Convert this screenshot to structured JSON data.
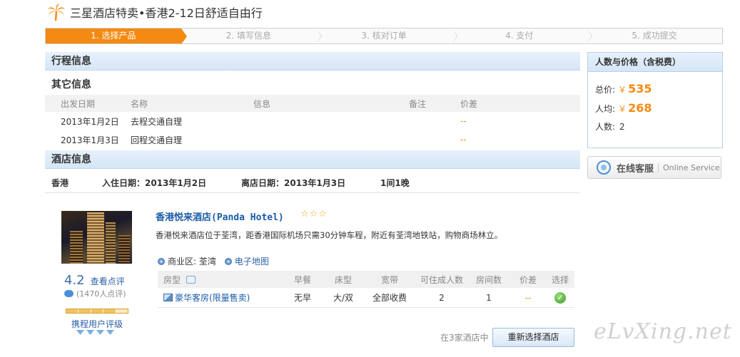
{
  "page": {
    "title": "三星酒店特卖•香港2-12日舒适自由行"
  },
  "steps": [
    {
      "label": "1. 选择产品"
    },
    {
      "label": "2. 填写信息"
    },
    {
      "label": "3. 核对订单"
    },
    {
      "label": "4. 支付"
    },
    {
      "label": "5. 成功提交"
    }
  ],
  "itinerary": {
    "section_title": "行程信息",
    "other_title": "其它信息",
    "headers": {
      "date": "出发日期",
      "name": "名称",
      "info": "信息",
      "note": "备注",
      "diff": "价差"
    },
    "rows": [
      {
        "date": "2013年1月2日",
        "name": "去程交通自理",
        "info": "",
        "note": "",
        "diff": "--"
      },
      {
        "date": "2013年1月3日",
        "name": "回程交通自理",
        "info": "",
        "note": "",
        "diff": "--"
      }
    ]
  },
  "hotel_info": {
    "section_title": "酒店信息",
    "city": "香港",
    "checkin": "入住日期：2013年1月2日",
    "checkout": "离店日期：2013年1月3日",
    "duration": "1间1晚"
  },
  "hotel": {
    "name": "香港悦来酒店(Panda Hotel)",
    "stars": "☆☆☆",
    "description": "香港悦来酒店位于荃湾，距香港国际机场只需30分钟车程，附近有荃湾地铁站，购物商场林立。",
    "district": "商业区: 荃湾",
    "map_link": "电子地图",
    "score": "4.2",
    "review_link": "查看点评",
    "review_count": "(1470人点评)",
    "rating_label": "携程用户评级",
    "user_rating_fraction": 0.8
  },
  "rooms": {
    "headers": {
      "type": "房型",
      "breakfast": "早餐",
      "bed": "床型",
      "broadband": "宽带",
      "adults": "可住成人数",
      "rooms": "房间数",
      "diff": "价差",
      "select": "选择"
    },
    "rows": [
      {
        "type": "豪华客房(限量售卖)",
        "breakfast": "无早",
        "bed": "大/双",
        "broadband": "全部收费",
        "adults": "2",
        "rooms": "1",
        "diff": "--",
        "select": "✓"
      }
    ]
  },
  "footer": {
    "note": "在3家酒店中",
    "reselect_button": "重新选择酒店"
  },
  "price_panel": {
    "title": "人数与价格（含税费）",
    "total_label": "总价:",
    "total_currency": "￥",
    "total_value": "535",
    "avg_label": "人均:",
    "avg_currency": "￥",
    "avg_value": "268",
    "count_label": "人数:",
    "count_value": "2"
  },
  "service": {
    "label": "在线客服",
    "sub": "Online Service"
  },
  "watermark": "eLvXing.net",
  "colors": {
    "accent": "#f58a12",
    "link": "#1a5ca8",
    "section_bg": "#dcebf8"
  }
}
